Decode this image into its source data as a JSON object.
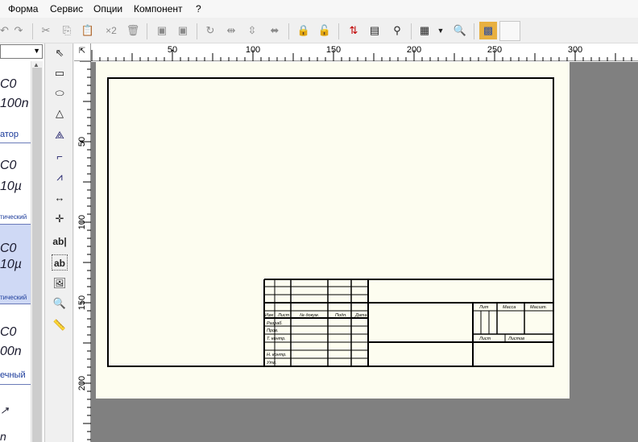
{
  "menu": {
    "items": [
      "Форма",
      "Сервис",
      "Опции",
      "Компонент",
      "?"
    ]
  },
  "toolbar": {
    "multiply_label": "×2"
  },
  "left_panel": {
    "components": [
      {
        "line1": "C0",
        "line2": "100n",
        "caption": "атор"
      },
      {
        "line1": "C0",
        "line2": "10µ",
        "caption": "тический"
      },
      {
        "line1": "C0",
        "line2": "10µ",
        "caption": "тический"
      },
      {
        "line1": "C0",
        "line2": "00n",
        "caption": "ечный"
      },
      {
        "line1": "n"
      }
    ]
  },
  "ruler": {
    "h_ticks": [
      "50",
      "100",
      "150",
      "200",
      "250",
      "300"
    ],
    "v_ticks": [
      "50",
      "100",
      "150",
      "200"
    ]
  },
  "title_block": {
    "izm": "Изм",
    "list": "Лист",
    "ndokum": "№ докум.",
    "podp": "Подп.",
    "data": "Дата",
    "razrab": "Разраб.",
    "prov": "Пров.",
    "tkontr": "Т. контр.",
    "nkontr": "Н. контр.",
    "utv": "Утв.",
    "lit": "Лит",
    "massa": "Масса",
    "masshtab": "Масшт.",
    "list2": "Лист",
    "listov": "Листов"
  }
}
